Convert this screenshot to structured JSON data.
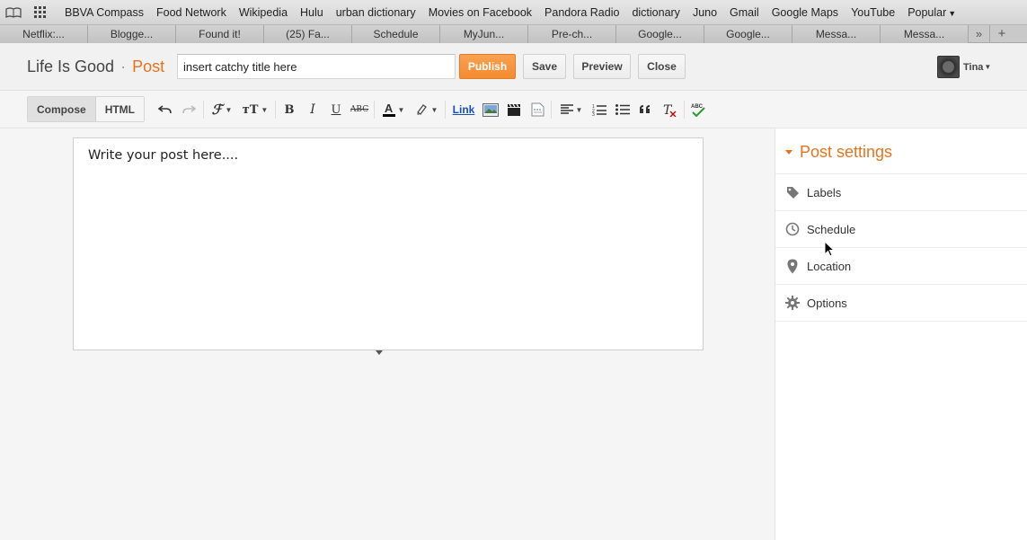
{
  "bookmarks": {
    "items": [
      "BBVA Compass",
      "Food Network",
      "Wikipedia",
      "Hulu",
      "urban dictionary",
      "Movies on Facebook",
      "Pandora Radio",
      "dictionary",
      "Juno",
      "Gmail",
      "Google Maps",
      "YouTube"
    ],
    "popular_label": "Popular"
  },
  "tabs": [
    "Netflix:...",
    "Blogge...",
    "Found it!",
    "(25) Fa...",
    "Schedule",
    "MyJun...",
    "Pre-ch...",
    "Google...",
    "Google...",
    "Messa...",
    "Messa..."
  ],
  "header": {
    "blog_name": "Life Is Good",
    "separator": "·",
    "section": "Post",
    "title_value": "insert catchy title here",
    "publish_label": "Publish",
    "save_label": "Save",
    "preview_label": "Preview",
    "close_label": "Close",
    "account_name": "Tina"
  },
  "toolbar": {
    "compose_label": "Compose",
    "html_label": "HTML",
    "link_label": "Link"
  },
  "editor": {
    "body_text": "Write your post here...."
  },
  "post_settings": {
    "title": "Post settings",
    "items": [
      {
        "label": "Labels",
        "icon": "tag-icon"
      },
      {
        "label": "Schedule",
        "icon": "clock-icon"
      },
      {
        "label": "Location",
        "icon": "location-pin-icon"
      },
      {
        "label": "Options",
        "icon": "gear-icon"
      }
    ]
  },
  "colors": {
    "accent": "#e8721c",
    "publish": "#f48b30"
  }
}
